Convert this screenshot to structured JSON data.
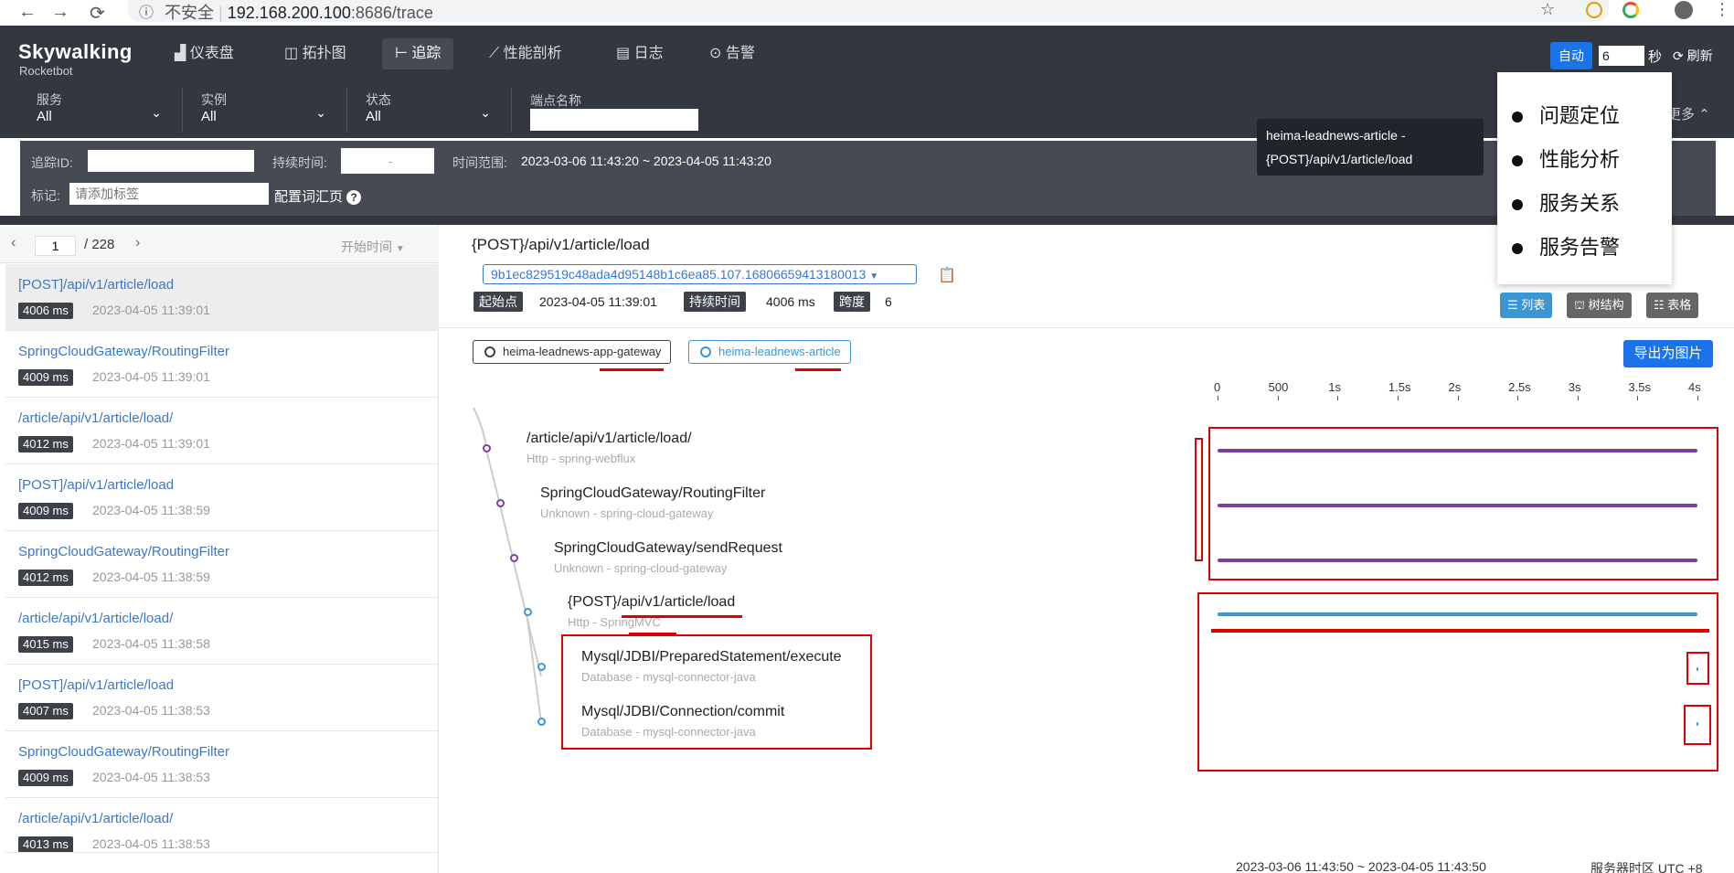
{
  "browser": {
    "security": "不安全",
    "url_host": "192.168.200.100",
    "url_rest": ":8686/trace"
  },
  "app": {
    "logo": "Skywalking",
    "sub": "Rocketbot"
  },
  "nav": [
    {
      "icon": "dashboard-icon",
      "label": "仪表盘"
    },
    {
      "icon": "topology-icon",
      "label": "拓扑图"
    },
    {
      "icon": "trace-icon",
      "label": "追踪",
      "active": true
    },
    {
      "icon": "profile-icon",
      "label": "性能剖析"
    },
    {
      "icon": "log-icon",
      "label": "日志"
    },
    {
      "icon": "alarm-icon",
      "label": "告警"
    }
  ],
  "toolbar": {
    "auto": "自动",
    "interval": "6",
    "seconds": "秒",
    "refresh": "刷新"
  },
  "filters": {
    "service": {
      "label": "服务",
      "value": "All"
    },
    "instance": {
      "label": "实例",
      "value": "All"
    },
    "status": {
      "label": "状态",
      "value": "All"
    },
    "endpoint_label": "端点名称",
    "trace_id_label": "追踪ID:",
    "duration_label": "持续时间:",
    "duration_sep": "-",
    "time_range_label": "时间范围:",
    "time_range": "2023-03-06 11:43:20 ~ 2023-04-05 11:43:20",
    "tag_label": "标记:",
    "tag_placeholder": "请添加标签",
    "config_vocab": "配置词汇页",
    "more": "更多"
  },
  "tooltip": {
    "text": "heima-leadnews-article - {POST}/api/v1/article/load"
  },
  "menu": [
    "问题定位",
    "性能分析",
    "服务关系",
    "服务告警"
  ],
  "pager": {
    "page": "1",
    "total": "/ 228",
    "sort": "开始时间"
  },
  "traces": [
    {
      "name": "[POST]/api/v1/article/load",
      "duration": "4006 ms",
      "time": "2023-04-05 11:39:01"
    },
    {
      "name": "SpringCloudGateway/RoutingFilter",
      "duration": "4009 ms",
      "time": "2023-04-05 11:39:01"
    },
    {
      "name": "/article/api/v1/article/load/",
      "duration": "4012 ms",
      "time": "2023-04-05 11:39:01"
    },
    {
      "name": "[POST]/api/v1/article/load",
      "duration": "4009 ms",
      "time": "2023-04-05 11:38:59"
    },
    {
      "name": "SpringCloudGateway/RoutingFilter",
      "duration": "4012 ms",
      "time": "2023-04-05 11:38:59"
    },
    {
      "name": "/article/api/v1/article/load/",
      "duration": "4015 ms",
      "time": "2023-04-05 11:38:58"
    },
    {
      "name": "[POST]/api/v1/article/load",
      "duration": "4007 ms",
      "time": "2023-04-05 11:38:53"
    },
    {
      "name": "SpringCloudGateway/RoutingFilter",
      "duration": "4009 ms",
      "time": "2023-04-05 11:38:53"
    },
    {
      "name": "/article/api/v1/article/load/",
      "duration": "4013 ms",
      "time": "2023-04-05 11:38:53"
    }
  ],
  "detail": {
    "title": "{POST}/api/v1/article/load",
    "trace_id": "9b1ec829519c48ada4d95148b1c6ea85.107.16806659413180013",
    "start_label": "起始点",
    "start": "2023-04-05 11:39:01",
    "duration_label": "持续时间",
    "duration": "4006 ms",
    "span_label": "跨度",
    "span_count": "6",
    "views": [
      "列表",
      "树结构",
      "表格"
    ],
    "services": [
      "heima-leadnews-app-gateway",
      "heima-leadnews-article"
    ],
    "export": "导出为图片",
    "axis": [
      "0",
      "500",
      "1s",
      "1.5s",
      "2s",
      "2.5s",
      "3s",
      "3.5s",
      "4s"
    ]
  },
  "spans": [
    {
      "name": "/article/api/v1/article/load/",
      "sub": "Http - spring-webflux",
      "service": 0
    },
    {
      "name": "SpringCloudGateway/RoutingFilter",
      "sub": "Unknown - spring-cloud-gateway",
      "service": 0
    },
    {
      "name": "SpringCloudGateway/sendRequest",
      "sub": "Unknown - spring-cloud-gateway",
      "service": 0
    },
    {
      "name": "{POST}/api/v1/article/load",
      "sub": "Http - SpringMVC",
      "service": 1
    },
    {
      "name": "Mysql/JDBI/PreparedStatement/execute",
      "sub": "Database - mysql-connector-java",
      "service": 1
    },
    {
      "name": "Mysql/JDBI/Connection/commit",
      "sub": "Database - mysql-connector-java",
      "service": 1
    }
  ],
  "colors": {
    "gateway": "#7b3fa0",
    "article": "#3a97d4",
    "accent": "#1a73e8"
  },
  "footer": {
    "range": "2023-03-06 11:43:50 ~ 2023-04-05 11:43:50",
    "tz": "服务器时区 UTC +8"
  }
}
